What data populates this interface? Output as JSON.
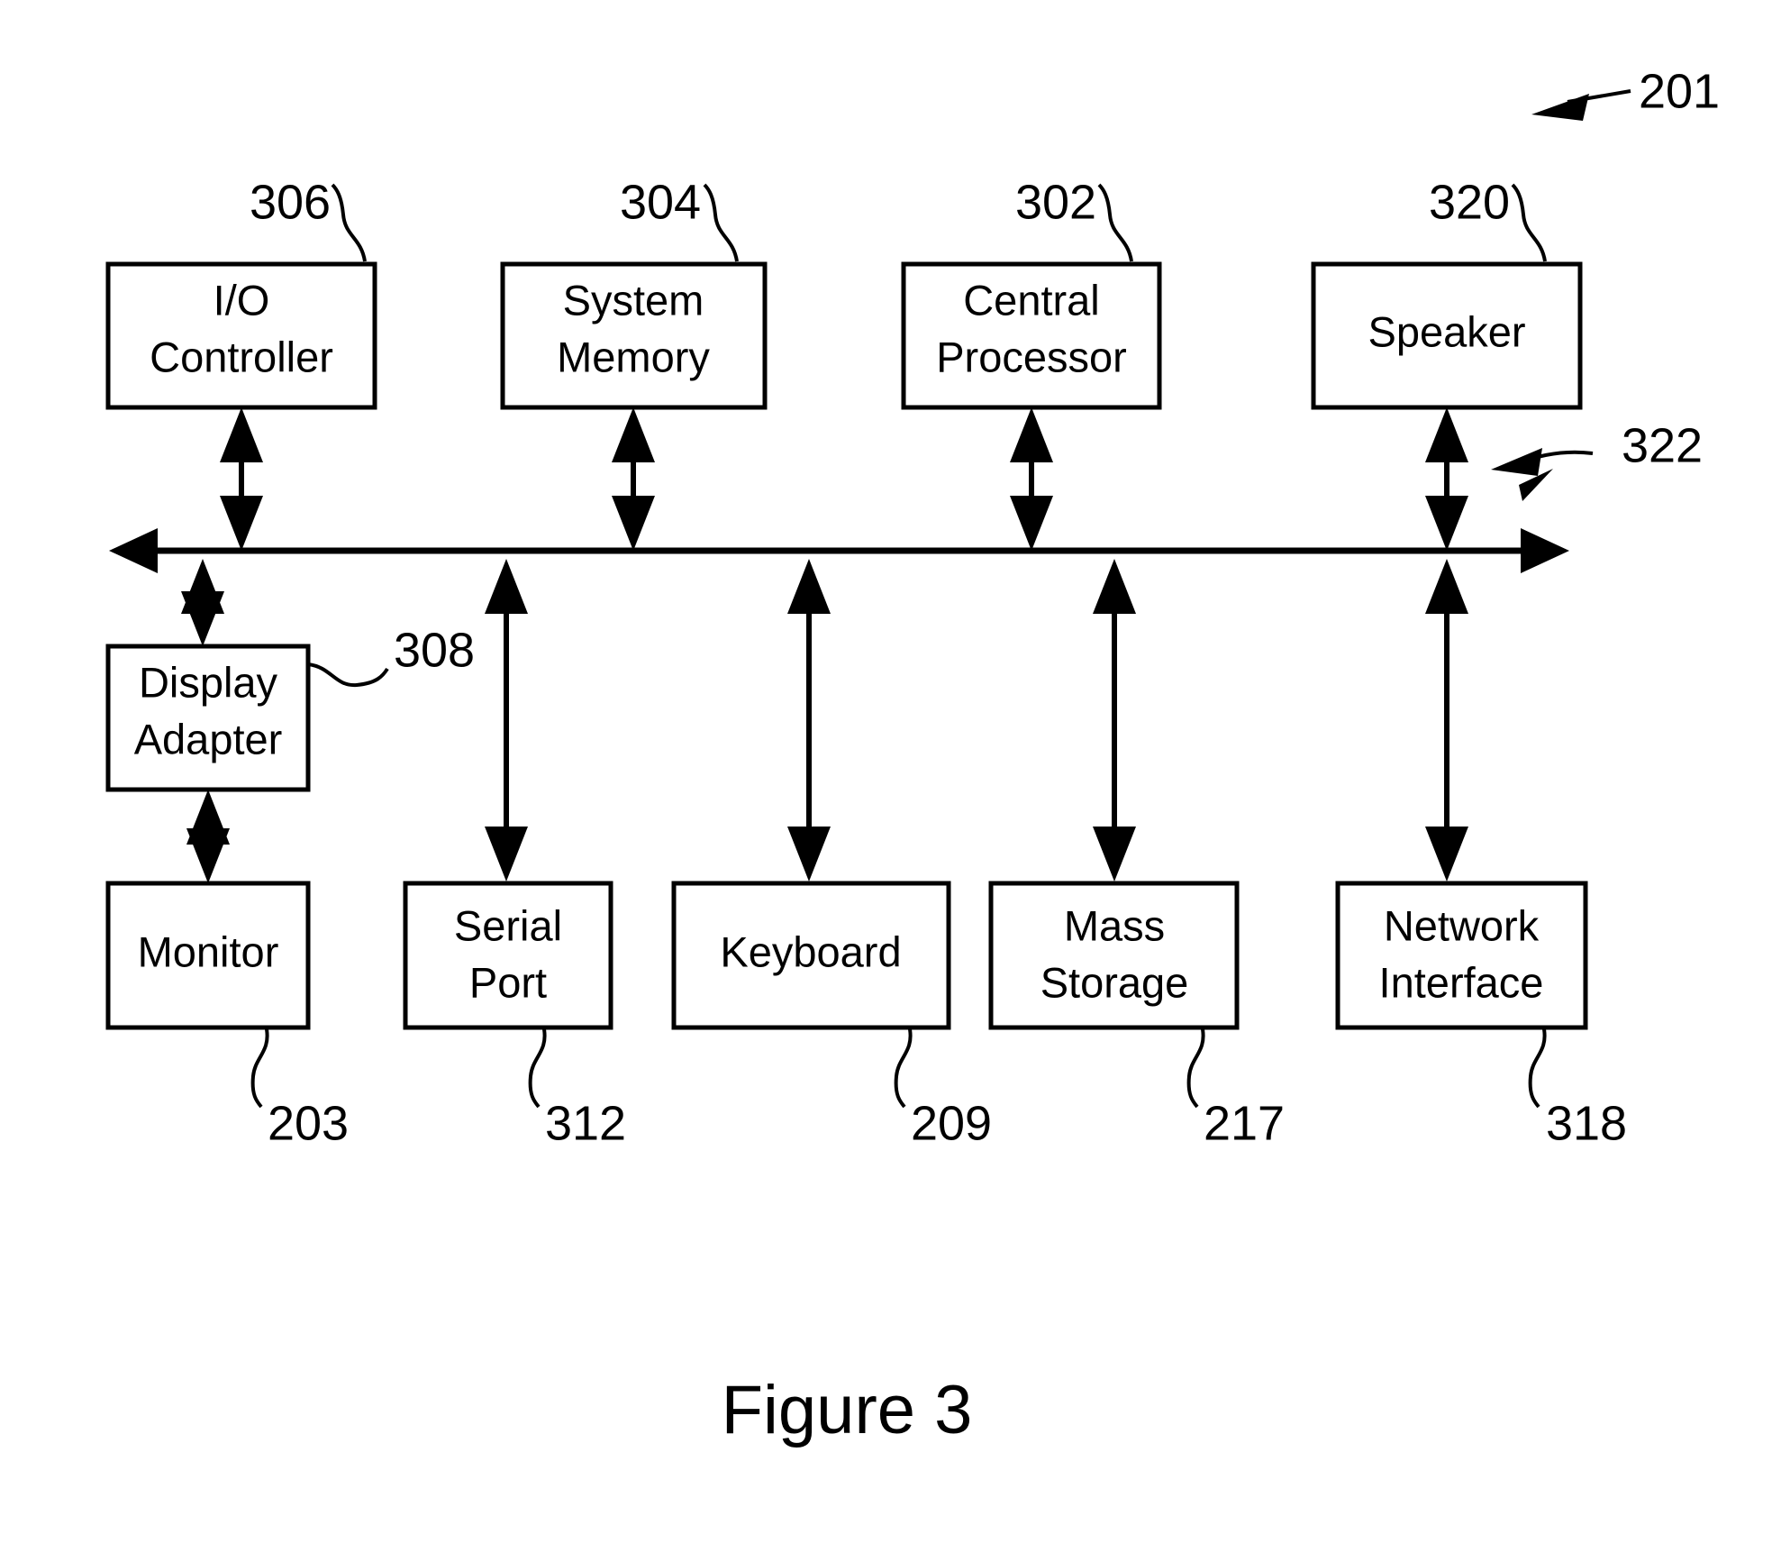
{
  "figure": {
    "caption": "Figure 3",
    "system_ref": "201",
    "bus_ref": "322"
  },
  "top_row": [
    {
      "label_line1": "I/O",
      "label_line2": "Controller",
      "ref": "306"
    },
    {
      "label_line1": "System",
      "label_line2": "Memory",
      "ref": "304"
    },
    {
      "label_line1": "Central",
      "label_line2": "Processor",
      "ref": "302"
    },
    {
      "label_line1": "Speaker",
      "label_line2": "",
      "ref": "320"
    }
  ],
  "middle_row": [
    {
      "label_line1": "Display",
      "label_line2": "Adapter",
      "ref": "308"
    }
  ],
  "bottom_row": [
    {
      "label_line1": "Monitor",
      "label_line2": "",
      "ref": "203"
    },
    {
      "label_line1": "Serial",
      "label_line2": "Port",
      "ref": "312"
    },
    {
      "label_line1": "Keyboard",
      "label_line2": "",
      "ref": "209"
    },
    {
      "label_line1": "Mass",
      "label_line2": "Storage",
      "ref": "217"
    },
    {
      "label_line1": "Network",
      "label_line2": "Interface",
      "ref": "318"
    }
  ],
  "colors": {
    "ink": "#000000",
    "paper": "#ffffff"
  }
}
